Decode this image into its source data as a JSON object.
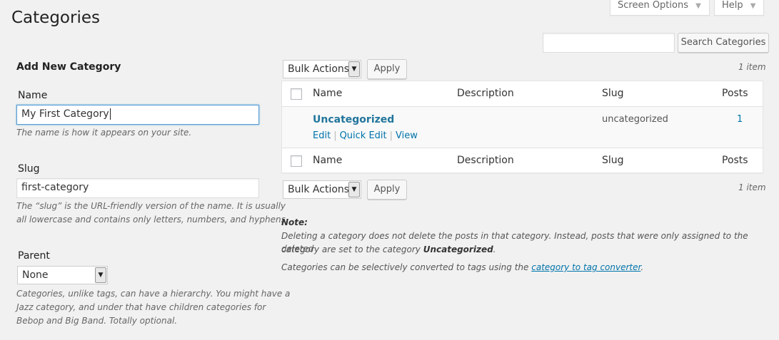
{
  "screen_meta": {
    "screen_options_label": "Screen Options",
    "help_label": "Help",
    "caret_glyph": "▼"
  },
  "page": {
    "title": "Categories"
  },
  "search": {
    "input_value": "",
    "button_label": "Search Categories"
  },
  "add_form": {
    "heading": "Add New Category",
    "name_label": "Name",
    "name_value": "My First Category",
    "name_help": "The name is how it appears on your site.",
    "slug_label": "Slug",
    "slug_value": "first-category",
    "slug_help_line1": "The “slug” is the URL-friendly version of the name. It is usually",
    "slug_help_line2": "all lowercase and contains only letters, numbers, and hyphens.",
    "parent_label": "Parent",
    "parent_selected": "None",
    "parent_help_line1": "Categories, unlike tags, can have a hierarchy. You might have a",
    "parent_help_line2": "Jazz category, and under that have children categories for",
    "parent_help_line3": "Bebop and Big Band. Totally optional."
  },
  "bulk": {
    "top_select": "Bulk Actions",
    "top_apply": "Apply",
    "bottom_select": "Bulk Actions",
    "bottom_apply": "Apply",
    "item_count_top": "1 item",
    "item_count_bottom": "1 item"
  },
  "table": {
    "columns": {
      "name": "Name",
      "description": "Description",
      "slug": "Slug",
      "posts": "Posts"
    },
    "rows": [
      {
        "name": "Uncategorized",
        "description": "",
        "slug": "uncategorized",
        "posts": "1",
        "actions": {
          "edit": "Edit",
          "quick_edit": "Quick Edit",
          "view": "View",
          "separator": "|"
        }
      }
    ]
  },
  "note": {
    "heading": "Note:",
    "line1": "Deleting a category does not delete the posts in that category. Instead, posts that were only assigned to the deleted",
    "line2_prefix": "category are set to the category",
    "line2_bold": "Uncategorized",
    "line2_suffix": ".",
    "line3_prefix": "Categories can be selectively converted to tags using the",
    "line3_link": "category to tag converter",
    "line3_suffix": "."
  },
  "colors": {
    "link": "#0073aa",
    "title_link": "#21759b",
    "background": "#f1f1f1"
  }
}
